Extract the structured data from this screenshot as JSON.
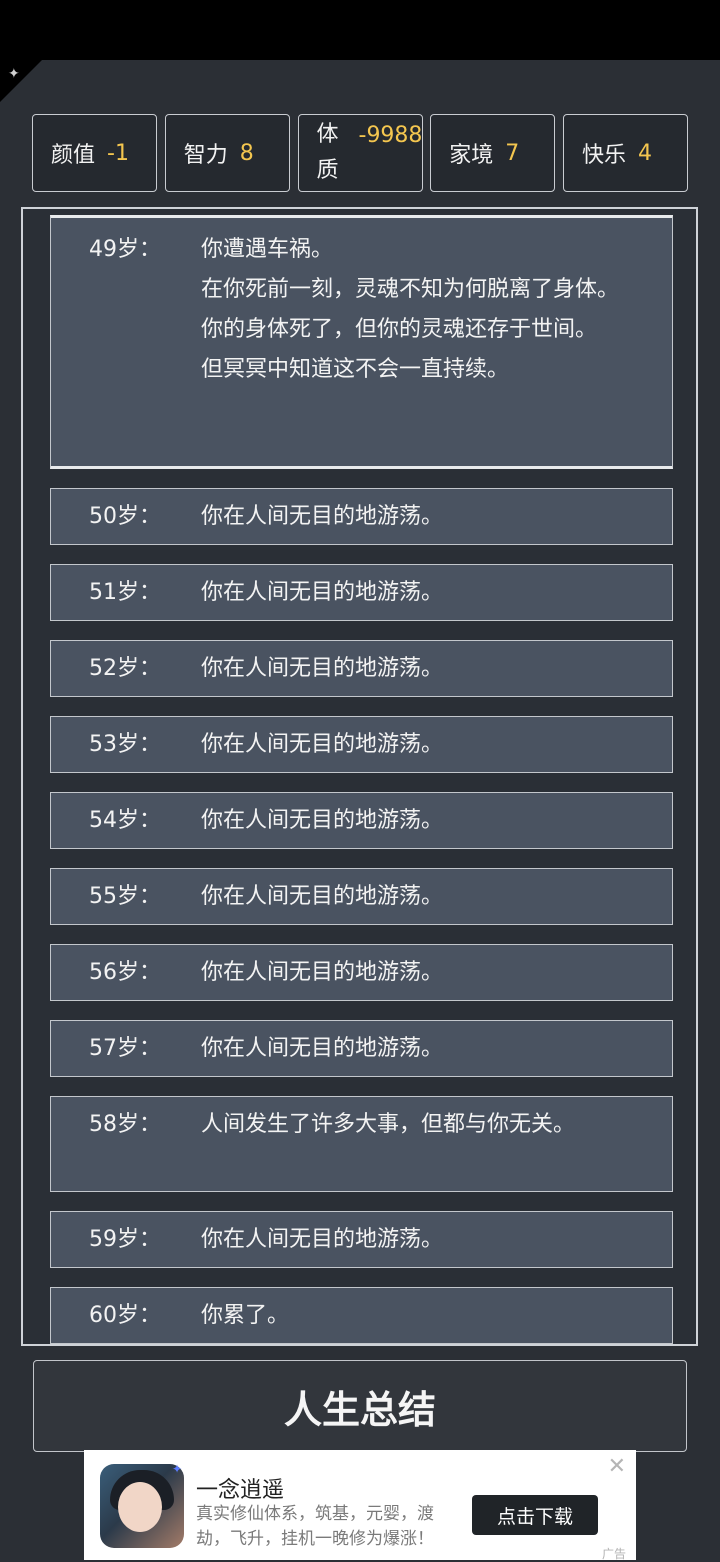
{
  "stats": [
    {
      "label": "颜值",
      "value": "-1"
    },
    {
      "label": "智力",
      "value": "8"
    },
    {
      "label": "体质",
      "value": "-9988"
    },
    {
      "label": "家境",
      "value": "7"
    },
    {
      "label": "快乐",
      "value": "4"
    }
  ],
  "log": [
    {
      "age": "49岁：",
      "text": "你遭遇车祸。\n在你死前一刻，灵魂不知为何脱离了身体。\n你的身体死了，但你的灵魂还存于世间。\n但冥冥中知道这不会一直持续。"
    },
    {
      "age": "50岁：",
      "text": "你在人间无目的地游荡。"
    },
    {
      "age": "51岁：",
      "text": "你在人间无目的地游荡。"
    },
    {
      "age": "52岁：",
      "text": "你在人间无目的地游荡。"
    },
    {
      "age": "53岁：",
      "text": "你在人间无目的地游荡。"
    },
    {
      "age": "54岁：",
      "text": "你在人间无目的地游荡。"
    },
    {
      "age": "55岁：",
      "text": "你在人间无目的地游荡。"
    },
    {
      "age": "56岁：",
      "text": "你在人间无目的地游荡。"
    },
    {
      "age": "57岁：",
      "text": "你在人间无目的地游荡。"
    },
    {
      "age": "58岁：",
      "text": "人间发生了许多大事，但都与你无关。"
    },
    {
      "age": "59岁：",
      "text": "你在人间无目的地游荡。"
    },
    {
      "age": "60岁：",
      "text": "你累了。"
    }
  ],
  "summary_button": "人生总结",
  "ad": {
    "title": "一念逍遥",
    "description": "真实修仙体系，筑基，元婴，渡劫，飞升，挂机一晚修为爆涨！",
    "button": "点击下载",
    "close": "✕",
    "tag": "广告"
  }
}
